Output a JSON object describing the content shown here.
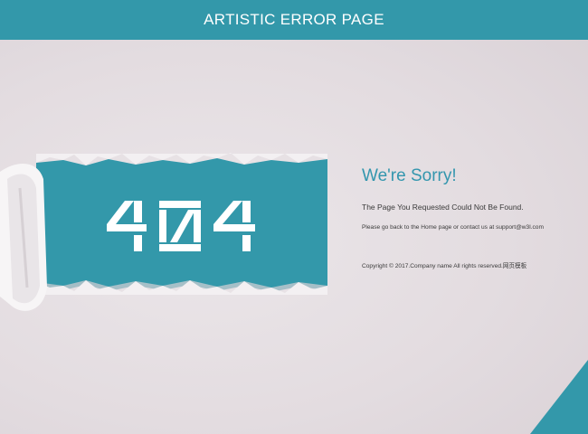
{
  "header": {
    "title": "ARTISTIC ERROR PAGE"
  },
  "error": {
    "code": "404"
  },
  "message": {
    "heading": "We're Sorry!",
    "not_found": "The Page You Requested Could Not Be Found.",
    "help": "Please go back to the Home page or contact us at support@w3l.com"
  },
  "footer": {
    "copyright": "Copyright © 2017.Company name All rights reserved.网页模板"
  },
  "colors": {
    "accent": "#3398aa",
    "background": "#e4dde1",
    "heading": "#3396ae"
  }
}
